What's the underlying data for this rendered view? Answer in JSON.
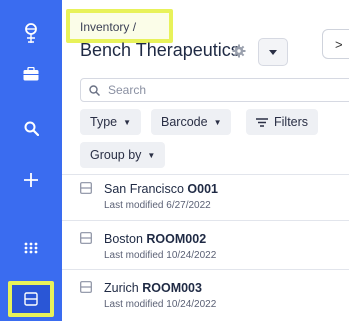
{
  "sidebar": {
    "items": [
      {
        "icon": "logo-icon"
      },
      {
        "icon": "briefcase-icon"
      },
      {
        "icon": "search-icon"
      },
      {
        "icon": "plus-icon"
      },
      {
        "icon": "apps-grid-icon"
      },
      {
        "icon": "inventory-icon",
        "active": true
      }
    ],
    "accent": "#3a6cf0",
    "highlight": "#e8f25a"
  },
  "header": {
    "breadcrumb": "Inventory /",
    "title": "Bench Therapeutics",
    "next_label": ">"
  },
  "search": {
    "placeholder": "Search"
  },
  "filters": {
    "type_label": "Type",
    "barcode_label": "Barcode",
    "filters_label": "Filters",
    "group_by_label": "Group by"
  },
  "locations": [
    {
      "name": "San Francisco",
      "code": "O001",
      "modified": "Last modified 6/27/2022"
    },
    {
      "name": "Boston",
      "code": "ROOM002",
      "modified": "Last modified 10/24/2022"
    },
    {
      "name": "Zurich",
      "code": "ROOM003",
      "modified": "Last modified 10/24/2022"
    }
  ]
}
